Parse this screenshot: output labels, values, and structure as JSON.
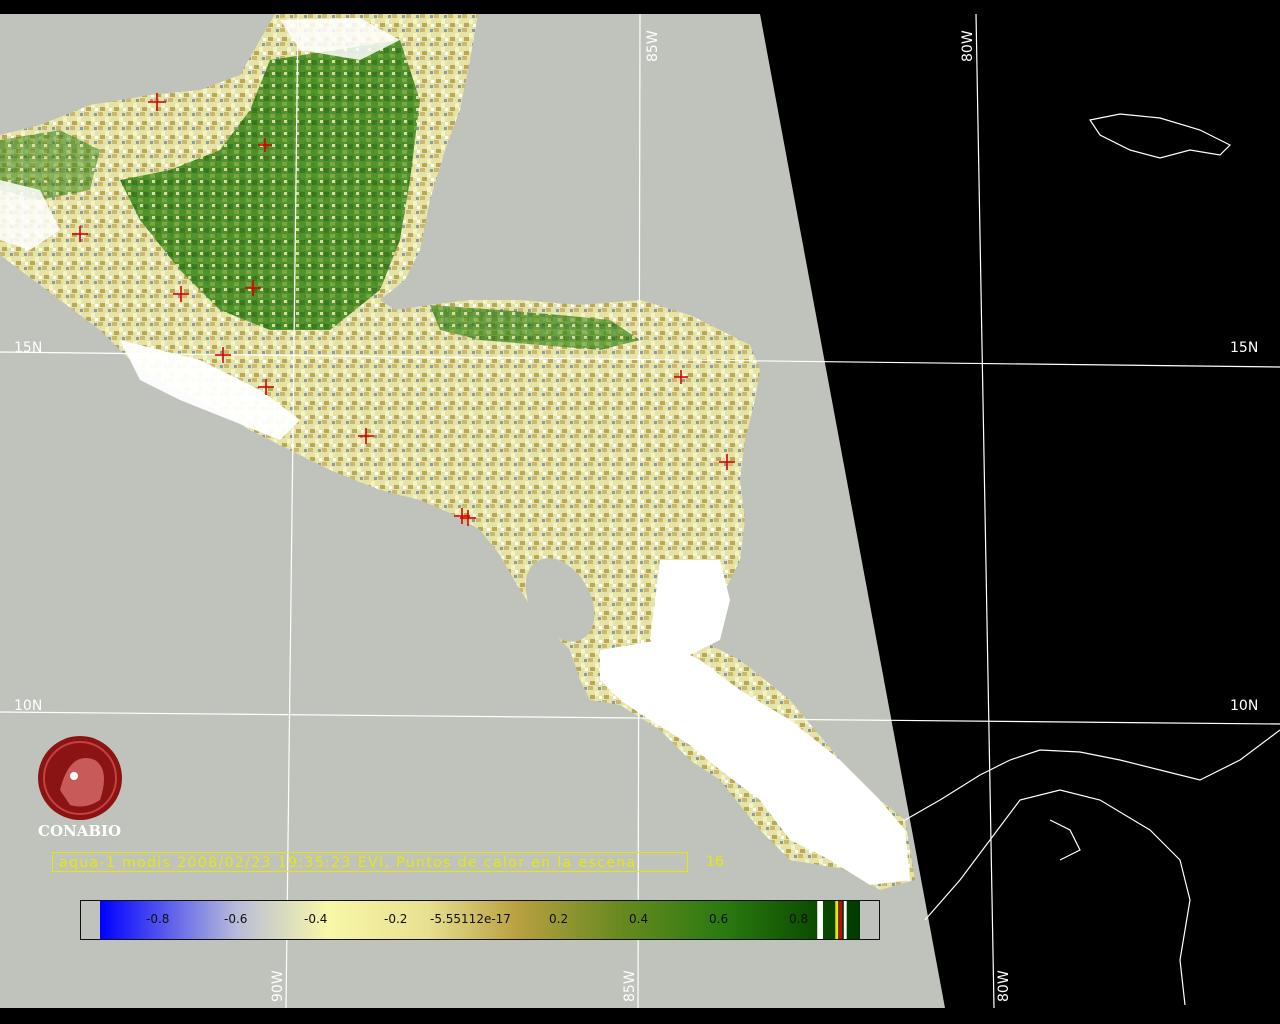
{
  "map": {
    "lat_labels": [
      "15N",
      "10N"
    ],
    "lon_labels_top": [
      "85W",
      "80W"
    ],
    "lon_labels_bottom": [
      "90W",
      "85W",
      "80W"
    ]
  },
  "caption": {
    "text": "aqua-1 modis 2008/02/23 19:35:23 EVI, Puntos de calor en la escena",
    "count": "16"
  },
  "colorbar": {
    "ticks": [
      "-0.8",
      "-0.6",
      "-0.4",
      "-0.2",
      "-5.55112e-17",
      "0.2",
      "0.4",
      "0.6",
      "0.8"
    ]
  },
  "logo": {
    "text": "CONABIO"
  },
  "colors": {
    "background": "#000000",
    "swath": "#c0c3bb",
    "grid": "#ffffff",
    "fire_marker": "#d80000",
    "caption": "#e8e800"
  }
}
